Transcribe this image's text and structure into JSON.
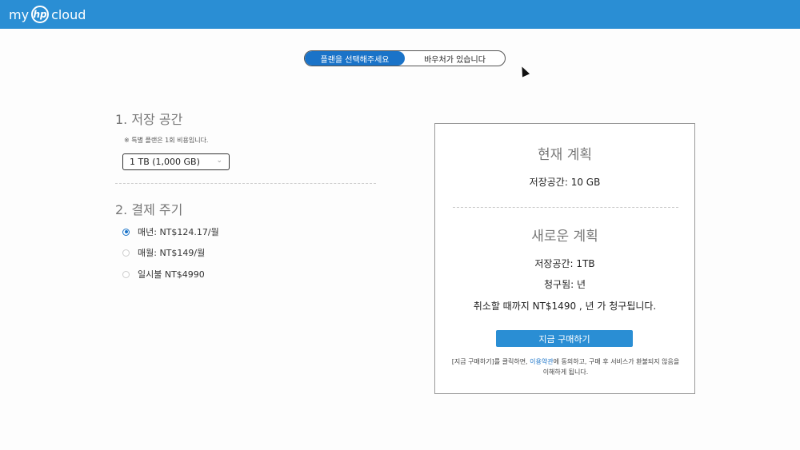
{
  "header": {
    "logo_my": "my",
    "logo_hp": "hp",
    "logo_cloud": "cloud"
  },
  "toggle": {
    "choose_plan_label": "플랜을 선택해주세요",
    "voucher_label": "바우처가 있습니다",
    "selected": "choose_plan"
  },
  "storage": {
    "title": "1. 저장 공간",
    "note": "※ 특별 플랜은 1회 비용입니다.",
    "selected_option": "1 TB (1,000 GB)"
  },
  "billing": {
    "title": "2. 결제 주기",
    "options": [
      {
        "label": "매년: NT$124.17/월",
        "checked": true
      },
      {
        "label": "매월: NT$149/월",
        "checked": false
      },
      {
        "label": "일시불 NT$4990",
        "checked": false
      }
    ]
  },
  "summary": {
    "current_title": "현재 계획",
    "current_storage": "저장공간:   10 GB",
    "new_title": "새로운 계획",
    "new_storage": "저장공간:   1TB",
    "billed": "청구됨:   년",
    "cancel_note": "취소할 때까지 NT$1490 , 년 가 청구됩니다.",
    "buy_button": "지금 구매하기",
    "terms_before": "[지금 구매하기]를 클릭하면, ",
    "terms_link": "이용약관",
    "terms_after": "에 동의하고, 구매 후 서비스가 환불되지 않음을 이해하게 됩니다."
  },
  "colors": {
    "header_bg": "#2a8ed4",
    "accent": "#1a73c8"
  }
}
